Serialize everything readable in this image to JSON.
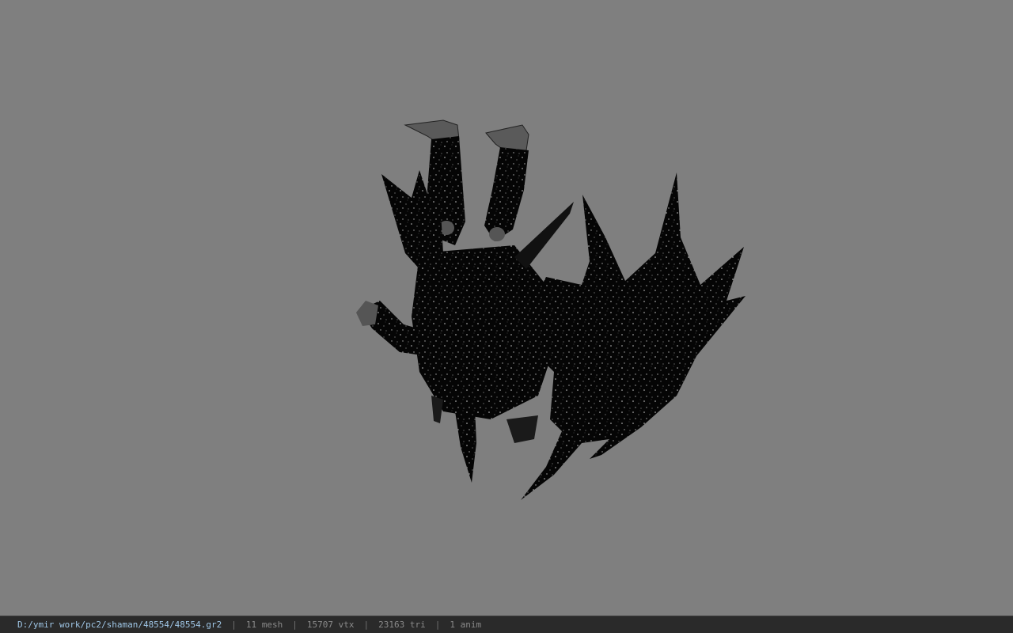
{
  "viewer": {
    "background_color": "#7f7f7f",
    "model_icon": "winged-creature-model"
  },
  "status_bar": {
    "file_path": "D:/ymir work/pc2/shaman/48554/48554.gr2",
    "separator": "|",
    "mesh_count": "11 mesh",
    "vertex_count": "15707 vtx",
    "triangle_count": "23163 tri",
    "anim_count": "1 anim",
    "path_color": "#9fc6e6",
    "text_color": "#8a8a8a"
  }
}
